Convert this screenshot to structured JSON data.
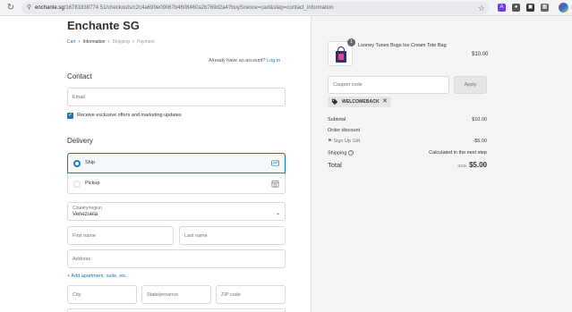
{
  "browser": {
    "url_host": "enchante.sg",
    "url_path": "/16781838774 51/checkouts/c2c4a699e09067b4608460a2b769d2a4?buyScence=cart&step=contact_information"
  },
  "store": {
    "title": "Enchante SG"
  },
  "breadcrumb": {
    "items": [
      "Cart",
      "Information",
      "Shipping",
      "Payment"
    ]
  },
  "contact": {
    "heading": "Contact",
    "account_prompt": "Already have an account?",
    "login_label": "Log in",
    "email_placeholder": "Email",
    "marketing_label": "Receive exclusive offers and marketing updates"
  },
  "delivery": {
    "heading": "Delivery",
    "options": [
      {
        "label": "Ship",
        "selected": true
      },
      {
        "label": "Pickup",
        "selected": false
      }
    ],
    "country_label": "Country/region",
    "country_value": "Venezuela",
    "first_name_placeholder": "First name",
    "last_name_placeholder": "Last name",
    "address_placeholder": "Address",
    "add_apartment_label": "+  Add apartment, suite, etc.",
    "city_placeholder": "City",
    "state_placeholder": "State/province",
    "zip_placeholder": "ZIP code"
  },
  "order": {
    "product_name": "Looney Tunes Bugs Ice Cream Tote Bag",
    "quantity": "1",
    "product_price": "$10.00",
    "coupon_placeholder": "Coupon code",
    "apply_label": "Apply",
    "discount_code": "WELCOMEBACK",
    "subtotal_label": "Subtotal",
    "subtotal_value": "$10.00",
    "order_discount_label": "Order discount",
    "gift_label": "Sign Up Gift",
    "gift_value": "-$5.00",
    "shipping_label": "Shipping",
    "shipping_value": "Calculated in the next step",
    "total_label": "Total",
    "total_currency": "SGD",
    "total_value": "$5.00"
  },
  "colors": {
    "accent": "#197bbd",
    "sidebar_bg": "#f5f5f5"
  },
  "icons": [
    "reload-icon",
    "lock-icon",
    "star-icon",
    "truck-icon",
    "store-icon",
    "tag-icon",
    "info-icon",
    "chevron-down-icon"
  ]
}
